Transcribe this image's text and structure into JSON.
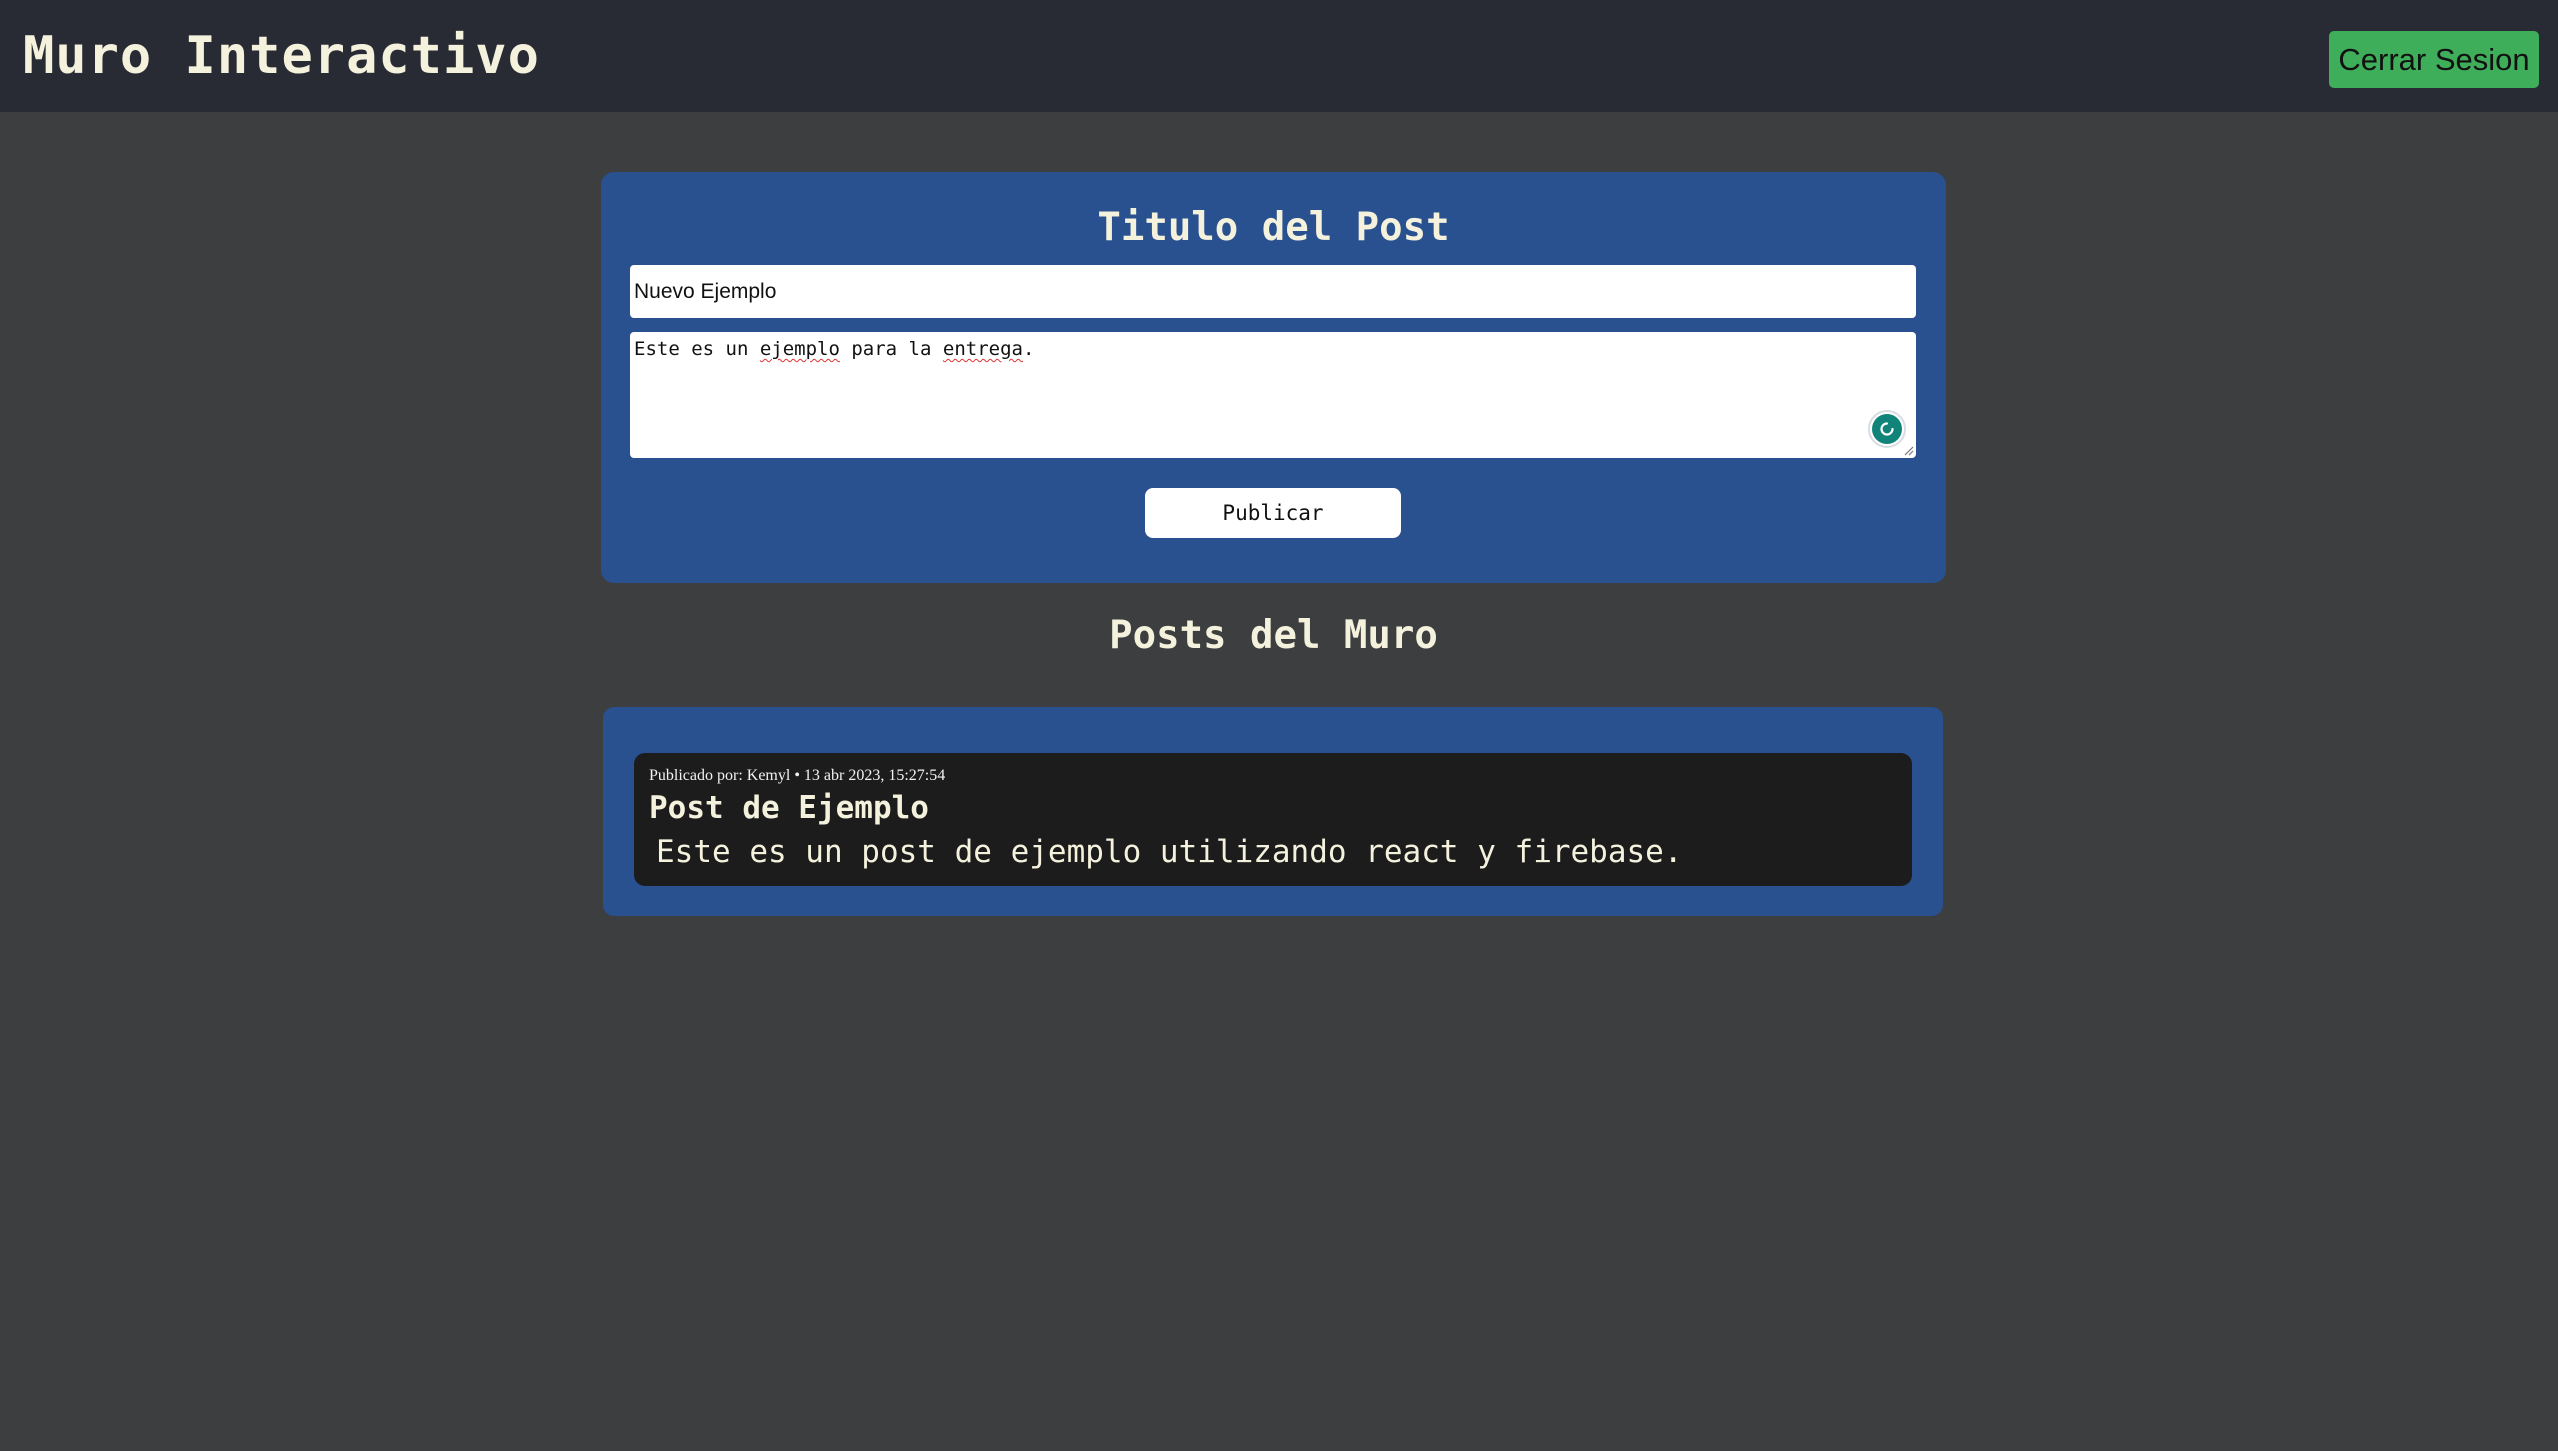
{
  "header": {
    "title": "Muro Interactivo",
    "logout_label": "Cerrar Sesion"
  },
  "composer": {
    "heading": "Titulo del Post",
    "title_value": "Nuevo Ejemplo",
    "body_parts": [
      "Este es un ",
      "ejemplo",
      " para la ",
      "entrega",
      "."
    ],
    "publish_label": "Publicar"
  },
  "wall": {
    "heading": "Posts del Muro",
    "posts": [
      {
        "meta": "Publicado por: Kemyl • 13 abr 2023, 15:27:54",
        "title": "Post de Ejemplo",
        "body": "Este es un post de ejemplo utilizando react y firebase."
      }
    ]
  },
  "colors": {
    "page_bg": "#3d3e40",
    "topbar_bg": "#282b33",
    "panel_bg": "#29508f",
    "logout_bg": "#3fae5a",
    "post_card_bg": "#1c1c1c",
    "heading_text": "#f4f1dc"
  },
  "icons": [
    "grammar-assistant-icon",
    "resize-grip-icon"
  ]
}
